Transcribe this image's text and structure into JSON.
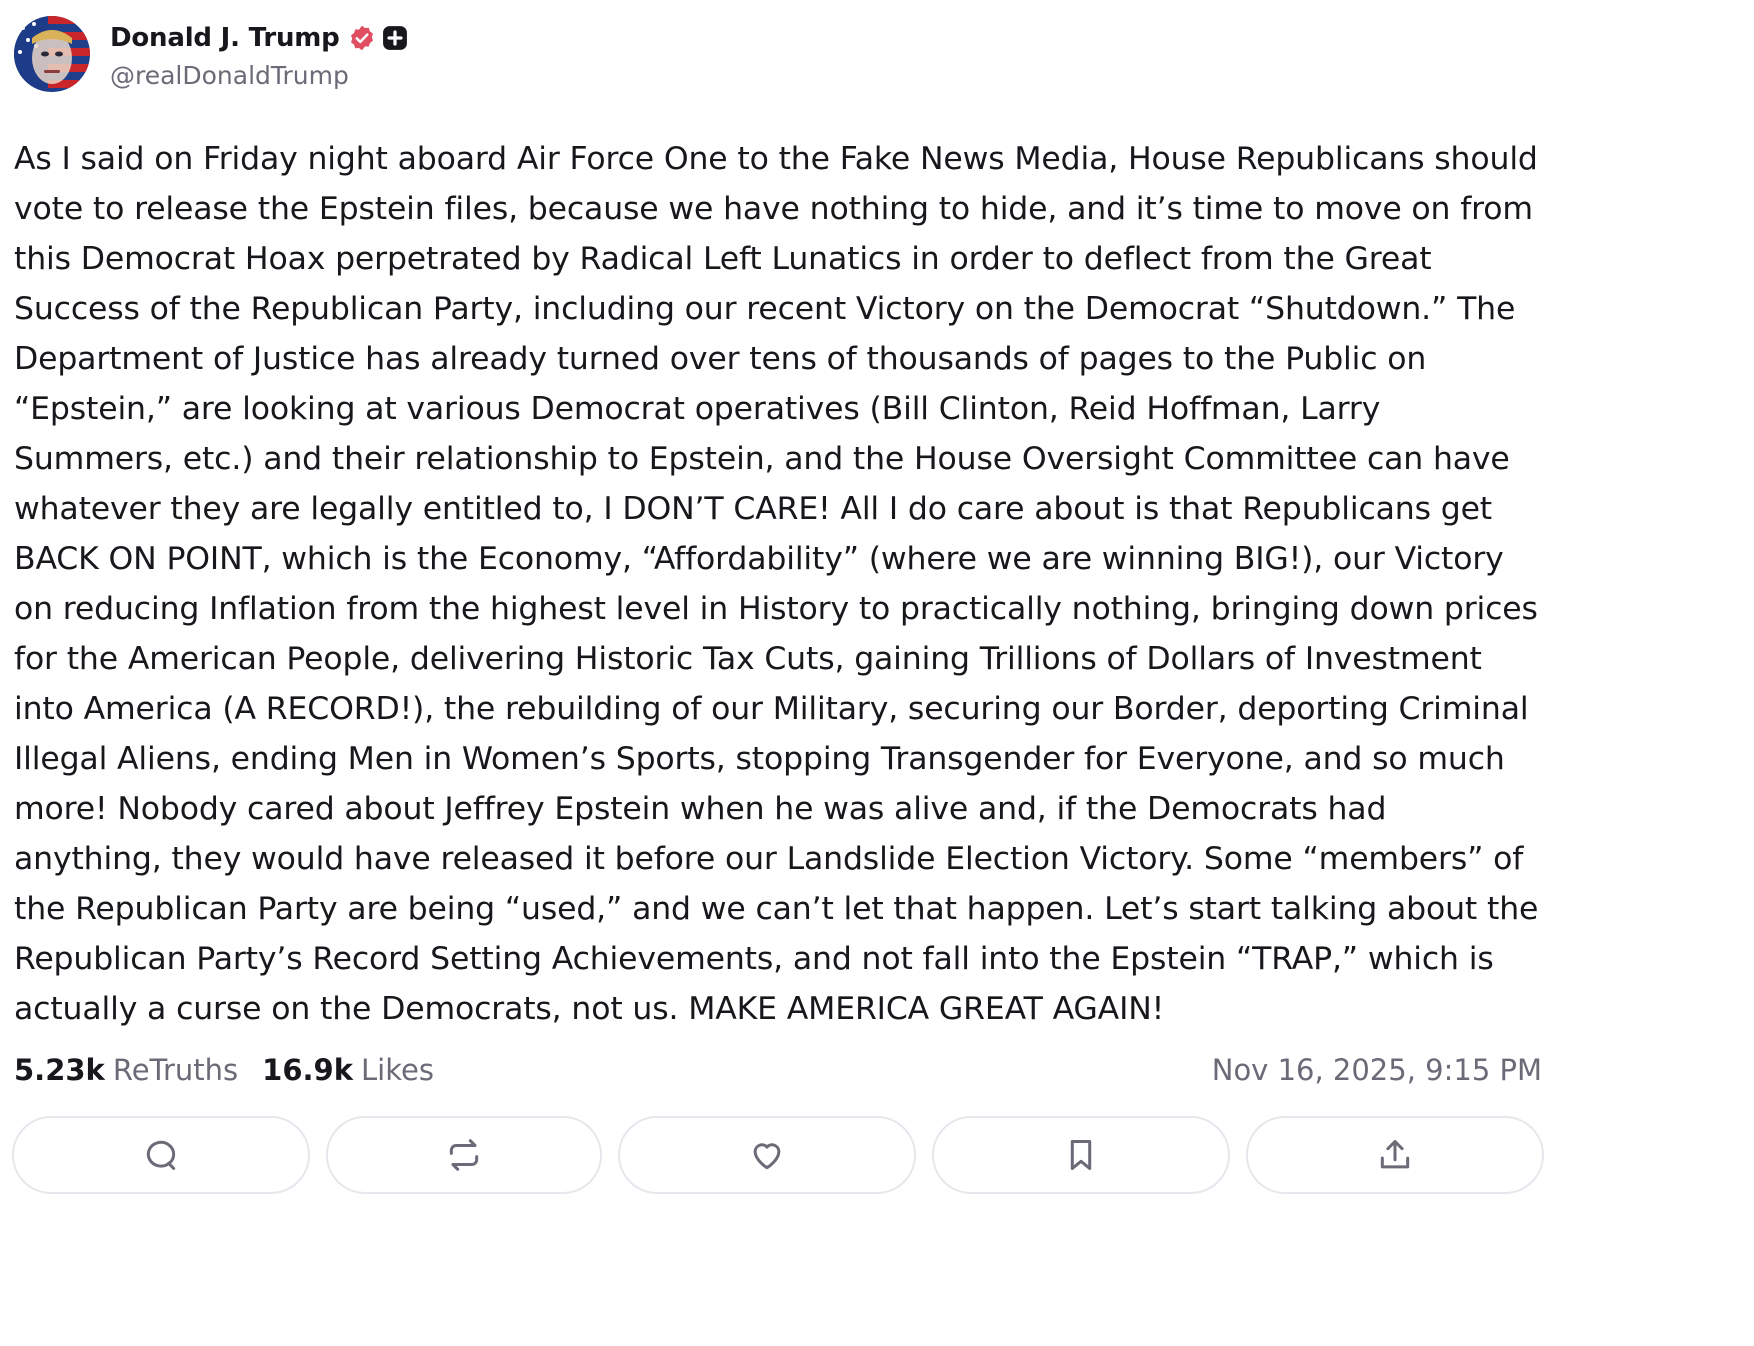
{
  "author": {
    "display_name": "Donald J. Trump",
    "handle": "@realDonaldTrump",
    "verified_icon": "verified-badge-icon",
    "plus_icon": "plus-badge-icon",
    "verified_color": "#e04e62"
  },
  "post": {
    "text": "As I said on Friday night aboard Air Force One to the Fake News Media, House Republicans should vote to release the Epstein files, because we have nothing to hide, and it’s time to move on from this Democrat Hoax perpetrated by Radical Left Lunatics in order to deflect from the Great Success of the Republican Party, including our recent Victory on the Democrat “Shutdown.” The Department of Justice has already turned over tens of thousands of pages to the Public on “Epstein,” are looking at various Democrat operatives (Bill Clinton, Reid Hoffman, Larry Summers, etc.) and their relationship to Epstein, and the House Oversight Committee can have whatever they are legally entitled to, I DON’T CARE! All I do care about is that Republicans get BACK ON POINT, which is the Economy, “Affordability” (where we are winning BIG!), our Victory on reducing Inflation from the highest level in History to practically nothing, bringing down prices for the American People, delivering Historic Tax Cuts, gaining Trillions of Dollars of Investment into America (A RECORD!), the rebuilding of our Military, securing our Border, deporting Criminal Illegal Aliens, ending Men in Women’s Sports, stopping Transgender for Everyone, and so much more! Nobody cared about Jeffrey Epstein when he was alive and, if the Democrats had anything, they would have released it before our Landslide Election Victory. Some “members” of the Republican Party are being “used,” and we can’t let that happen. Let’s start talking about the Republican Party’s Record Setting Achievements, and not fall into the Epstein “TRAP,” which is actually a curse on the Democrats, not us. MAKE AMERICA GREAT AGAIN!",
    "stats": {
      "retruths_count": "5.23k",
      "retruths_label": "ReTruths",
      "likes_count": "16.9k",
      "likes_label": "Likes"
    },
    "timestamp": "Nov 16, 2025, 9:15 PM"
  },
  "actions": [
    {
      "name": "reply",
      "icon": "comment-icon"
    },
    {
      "name": "retruth",
      "icon": "repost-icon"
    },
    {
      "name": "like",
      "icon": "heart-icon"
    },
    {
      "name": "bookmark",
      "icon": "bookmark-icon"
    },
    {
      "name": "share",
      "icon": "share-icon"
    }
  ],
  "colors": {
    "text": "#17171c",
    "muted": "#6b6b78",
    "button_border": "#e6e6ec"
  }
}
